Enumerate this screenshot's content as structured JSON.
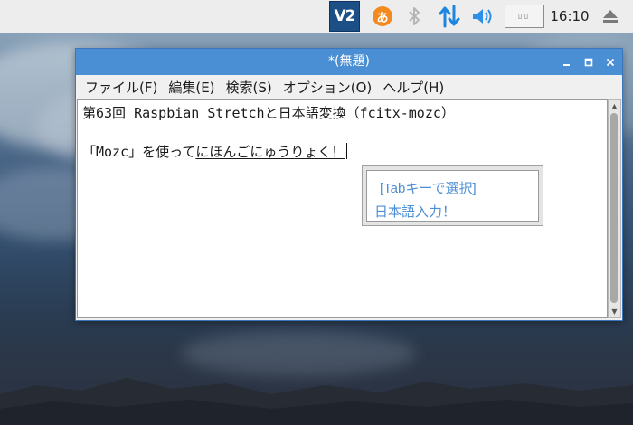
{
  "tray": {
    "vnc_label": "V2",
    "ime_label": "あ",
    "clock": "16:10",
    "cpu_monitor": "▯▯",
    "icons": [
      "vnc-icon",
      "ime-mozc-icon",
      "bluetooth-icon",
      "network-icon",
      "volume-icon",
      "cpu-monitor",
      "eject-icon"
    ]
  },
  "window": {
    "title": "*(無題)",
    "menu": [
      "ファイル(F)",
      "編集(E)",
      "検索(S)",
      "オプション(O)",
      "ヘルプ(H)"
    ],
    "editor": {
      "line1": "第63回 Raspbian Stretchと日本語変換（fcitx-mozc）",
      "line2_committed": "「Mozc」を使って",
      "line2_preedit": "にほんごにゅうりょく！"
    }
  },
  "ime_candidate": {
    "hint": "[Tabキーで選択]",
    "candidate": "日本語入力！"
  },
  "colors": {
    "titlebar": "#4a8ed3",
    "candidate_text": "#4d8fd6",
    "ime_orange": "#f28a20",
    "vnc_blue": "#1b4f86"
  }
}
